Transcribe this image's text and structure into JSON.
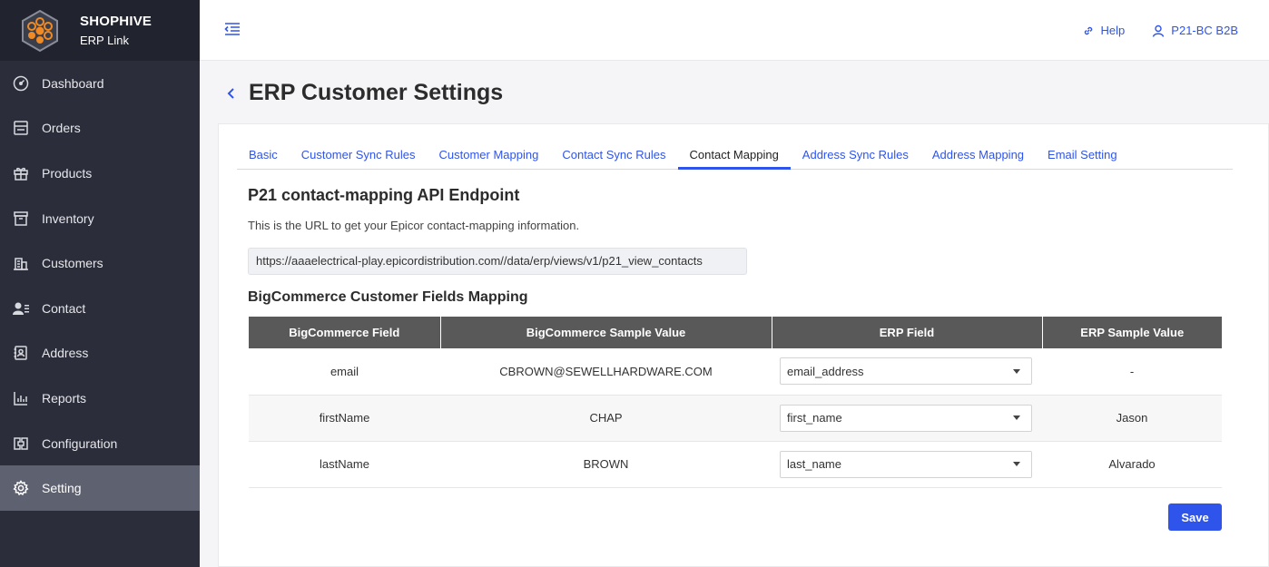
{
  "brand": {
    "name": "SHOPHIVE",
    "sub": "ERP Link",
    "logo_color": "#f08a24"
  },
  "sidebar": {
    "items": [
      {
        "label": "Dashboard",
        "icon": "dashboard-icon",
        "active": false
      },
      {
        "label": "Orders",
        "icon": "orders-icon",
        "active": false
      },
      {
        "label": "Products",
        "icon": "gift-icon",
        "active": false
      },
      {
        "label": "Inventory",
        "icon": "archive-icon",
        "active": false
      },
      {
        "label": "Customers",
        "icon": "building-icon",
        "active": false
      },
      {
        "label": "Contact",
        "icon": "contact-icon",
        "active": false
      },
      {
        "label": "Address",
        "icon": "address-book-icon",
        "active": false
      },
      {
        "label": "Reports",
        "icon": "bar-chart-icon",
        "active": false
      },
      {
        "label": "Configuration",
        "icon": "configuration-icon",
        "active": false
      },
      {
        "label": "Setting",
        "icon": "gear-icon",
        "active": true
      }
    ]
  },
  "topbar": {
    "help_label": "Help",
    "user_label": "P21-BC B2B",
    "accent": "#2f54eb"
  },
  "page": {
    "title": "ERP Customer Settings"
  },
  "tabs": [
    {
      "label": "Basic",
      "active": false
    },
    {
      "label": "Customer Sync Rules",
      "active": false
    },
    {
      "label": "Customer Mapping",
      "active": false
    },
    {
      "label": "Contact Sync Rules",
      "active": false
    },
    {
      "label": "Contact Mapping",
      "active": true
    },
    {
      "label": "Address Sync Rules",
      "active": false
    },
    {
      "label": "Address Mapping",
      "active": false
    },
    {
      "label": "Email Setting",
      "active": false
    }
  ],
  "endpoint": {
    "title": "P21 contact-mapping API Endpoint",
    "description": "This is the URL to get your Epicor contact-mapping information.",
    "url": "https://aaaelectrical-play.epicordistribution.com//data/erp/views/v1/p21_view_contacts"
  },
  "mapping": {
    "title": "BigCommerce Customer Fields Mapping",
    "headers": [
      "BigCommerce Field",
      "BigCommerce Sample Value",
      "ERP Field",
      "ERP Sample Value"
    ],
    "rows": [
      {
        "bc_field": "email",
        "bc_sample": "CBROWN@SEWELLHARDWARE.COM",
        "erp_field": "email_address",
        "erp_sample": "-"
      },
      {
        "bc_field": "firstName",
        "bc_sample": "CHAP",
        "erp_field": "first_name",
        "erp_sample": "Jason"
      },
      {
        "bc_field": "lastName",
        "bc_sample": "BROWN",
        "erp_field": "last_name",
        "erp_sample": "Alvarado"
      }
    ]
  },
  "save_label": "Save"
}
